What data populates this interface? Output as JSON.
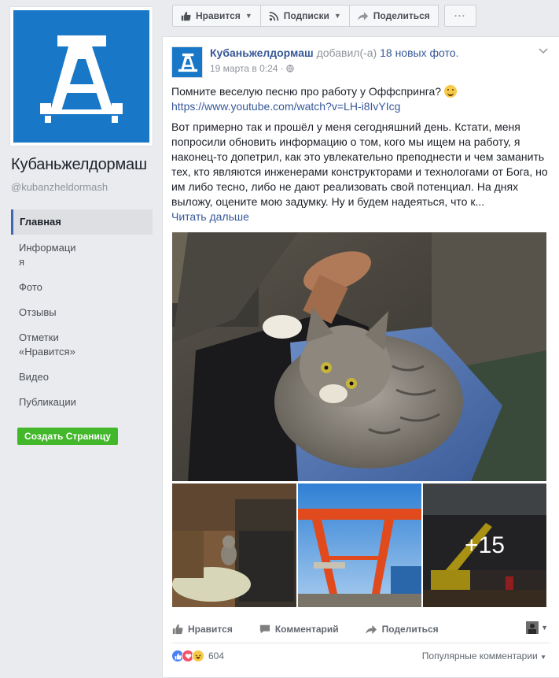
{
  "sidebar": {
    "page_name": "Кубаньжелдормаш",
    "page_handle": "@kubanzheldormash",
    "nav": [
      {
        "label": "Главная",
        "active": true
      },
      {
        "label": "Информаци\nя",
        "active": false
      },
      {
        "label": "Фото",
        "active": false
      },
      {
        "label": "Отзывы",
        "active": false
      },
      {
        "label": "Отметки\n«Нравится»",
        "active": false
      },
      {
        "label": "Видео",
        "active": false
      },
      {
        "label": "Публикации",
        "active": false
      }
    ],
    "create_page_label": "Создать Страницу"
  },
  "action_bar": {
    "like_label": "Нравится",
    "subscribe_label": "Подписки",
    "share_label": "Поделиться",
    "more_label": "···"
  },
  "post": {
    "author": "Кубаньжелдормаш",
    "action_text": "добавил(-а)",
    "photos_link": "18 новых фото.",
    "timestamp": "19 марта в 0:24 · ",
    "paragraph1": "Помните веселую песню про работу у Оффспринга?",
    "url": "https://www.youtube.com/watch?v=LH-i8IvYIcg",
    "paragraph2": "Вот примерно так и прошёл у меня сегодняшний день. Кстати, меня попросили обновить информацию о том, кого мы ищем на работу, я наконец-то допетрил, как это увлекательно преподнести и чем заманить тех, кто являются инженерами конструкторами и технологами от Бога, но им либо тесно, либо не дают реализовать свой потенциал. На днях выложу, оцените мою задумку. Ну и будем надеяться, что к...",
    "read_more": "Читать дальше",
    "more_photos": "+15",
    "actions": {
      "like": "Нравится",
      "comment": "Комментарий",
      "share": "Поделиться"
    },
    "reaction_count": "604",
    "comments_sort": "Популярные комментарии"
  },
  "colors": {
    "brand_blue": "#1877c7",
    "link": "#385898",
    "create_green": "#42b72a"
  }
}
